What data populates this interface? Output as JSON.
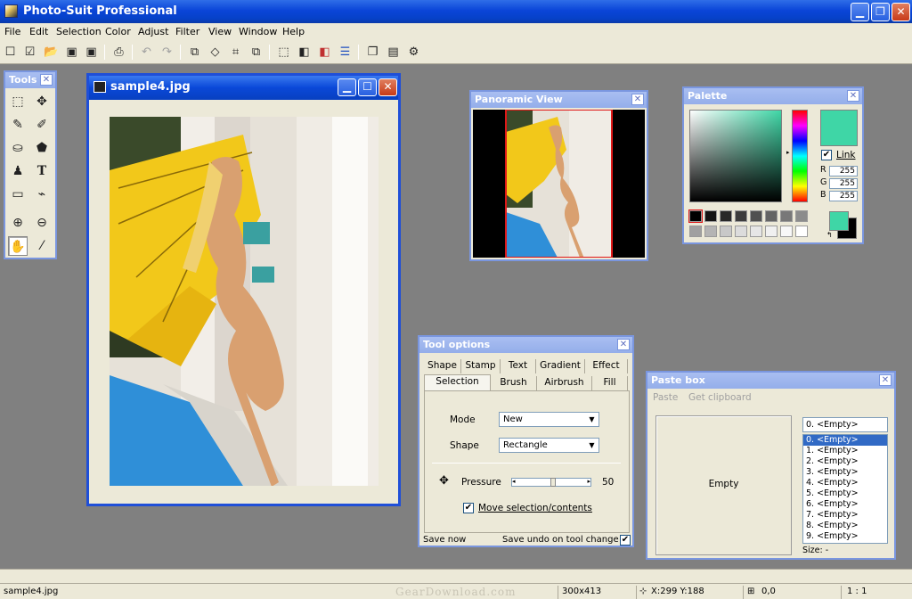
{
  "app": {
    "title": "Photo-Suit Professional"
  },
  "menu": [
    "File",
    "Edit",
    "Selection",
    "Color",
    "Adjust",
    "Filter",
    "View",
    "Window",
    "Help"
  ],
  "toolbar": {
    "icons": [
      "new-icon",
      "check-icon",
      "open-icon",
      "save-icon",
      "save-all-icon",
      "print-icon",
      "undo-icon",
      "redo-icon",
      "copy-icon",
      "paste-icon",
      "crop-icon",
      "duplicate-icon",
      "select-all-icon",
      "deselect-icon",
      "color-fill-icon",
      "channels-icon",
      "layers-icon",
      "properties-icon",
      "about-icon"
    ]
  },
  "tools": {
    "title": "Tools",
    "text_tool": "T"
  },
  "document": {
    "title": "sample4.jpg"
  },
  "panoramic": {
    "title": "Panoramic View"
  },
  "palette": {
    "title": "Palette",
    "link_label": "Link",
    "r_label": "R",
    "g_label": "G",
    "b_label": "B",
    "r": "255",
    "g": "255",
    "b": "255",
    "current_color": "#3fd6a6",
    "swatches": [
      "#000000",
      "#141414",
      "#282828",
      "#3c3c3c",
      "#505050",
      "#646464",
      "#787878",
      "#8c8c8c",
      "#a0a0a0",
      "#b4b4b4",
      "#c8c8c8",
      "#dcdcdc",
      "#e6e6e6",
      "#f0f0f0",
      "#f8f8f8",
      "#ffffff"
    ]
  },
  "tool_options": {
    "title": "Tool options",
    "tabs_row1": [
      "Shape",
      "Stamp",
      "Text",
      "Gradient",
      "Effect"
    ],
    "tabs_row2": [
      "Selection",
      "Brush",
      "Airbrush",
      "Fill"
    ],
    "active_tab": "Selection",
    "mode_label": "Mode",
    "mode_value": "New",
    "shape_label": "Shape",
    "shape_value": "Rectangle",
    "pressure_label": "Pressure",
    "pressure_value": "50",
    "move_label": "Move selection/contents",
    "save_now": "Save now",
    "save_undo": "Save undo on tool change"
  },
  "paste_box": {
    "title": "Paste box",
    "paste": "Paste",
    "get_clipboard": "Get clipboard",
    "preview_text": "Empty",
    "selected": "0. <Empty>",
    "items": [
      "0. <Empty>",
      "1. <Empty>",
      "2. <Empty>",
      "3. <Empty>",
      "4. <Empty>",
      "5. <Empty>",
      "6. <Empty>",
      "7. <Empty>",
      "8. <Empty>",
      "9. <Empty>"
    ],
    "size_label": "Size: -"
  },
  "status": {
    "file": "sample4.jpg",
    "watermark": "GearDownload.com",
    "dims": "300x413",
    "coords": "X:299 Y:188",
    "offset": "0,0",
    "zoom": "1 : 1"
  }
}
